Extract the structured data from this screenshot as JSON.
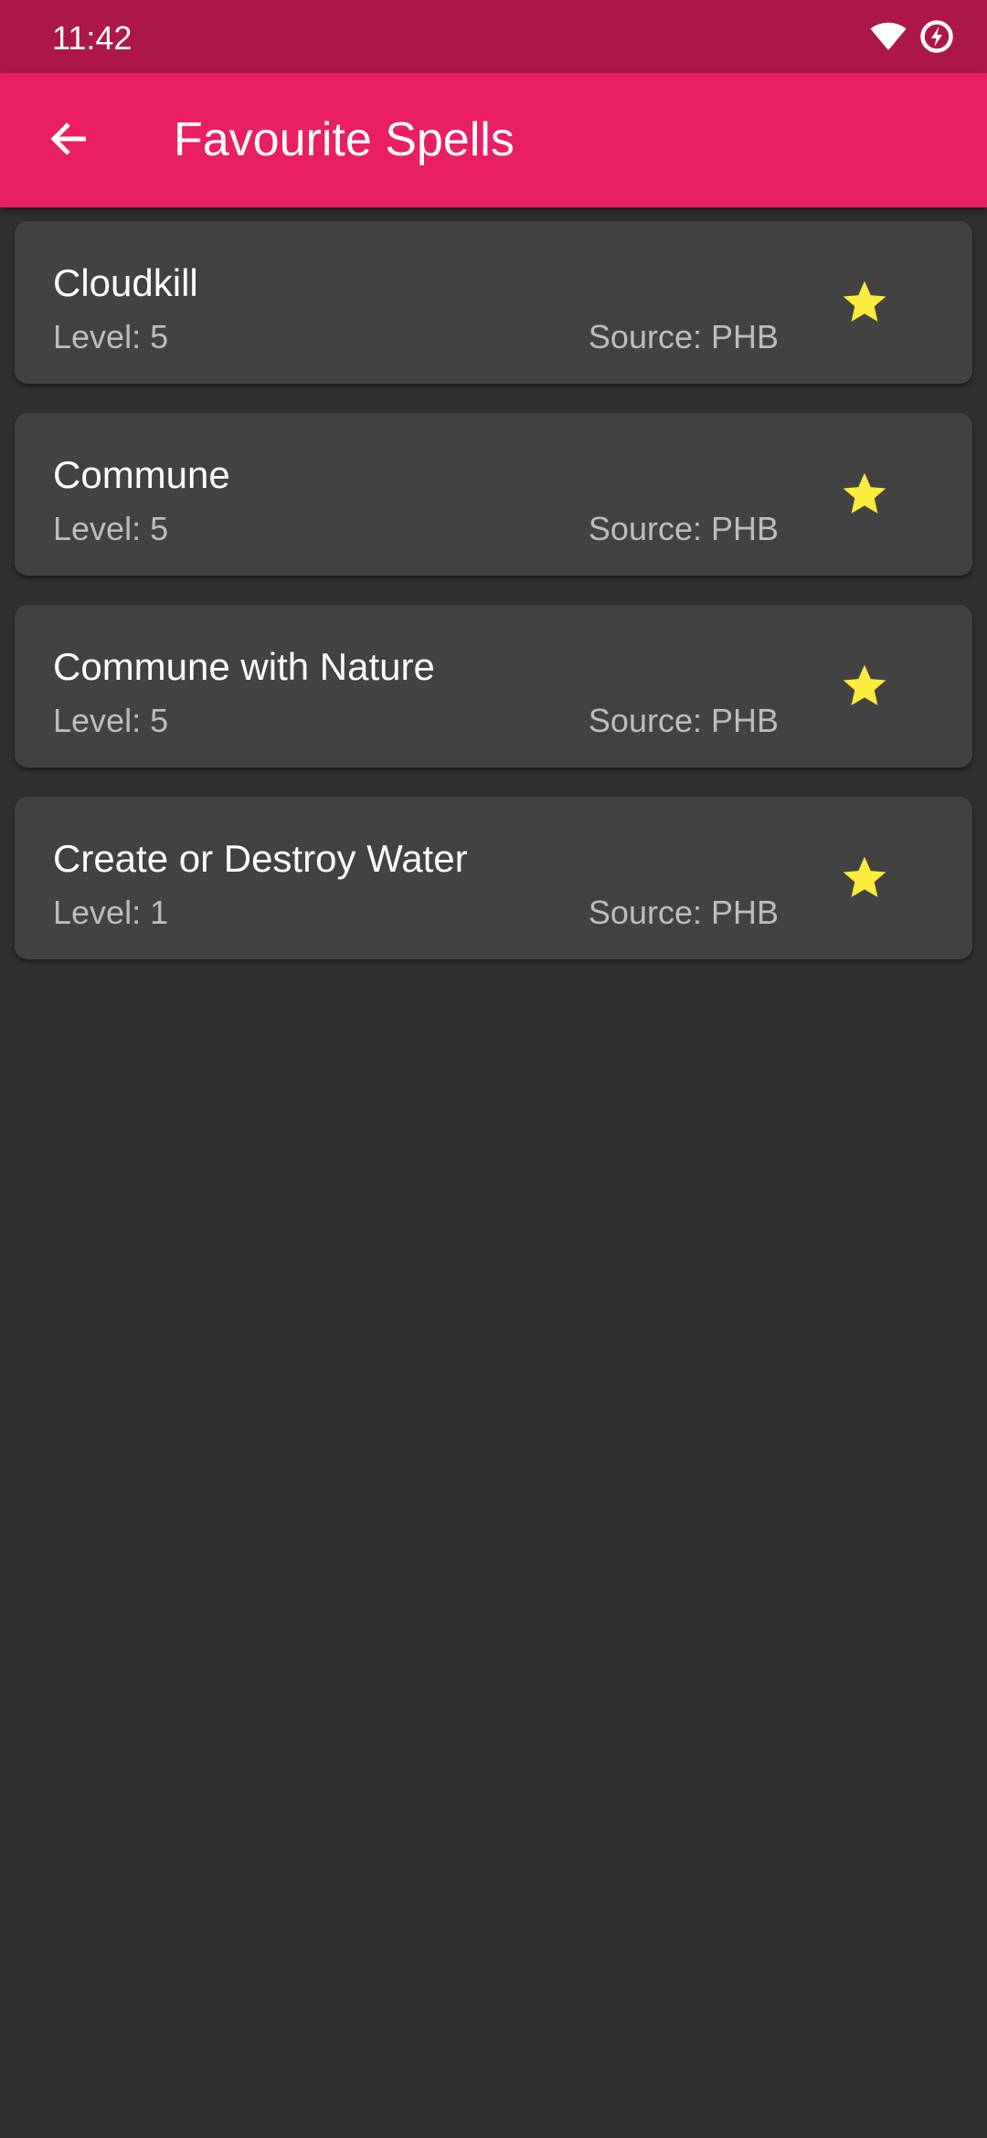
{
  "status_bar": {
    "time": "11:42",
    "icons": [
      "wifi-icon",
      "battery-charging-icon"
    ]
  },
  "app_bar": {
    "title": "Favourite Spells",
    "back_icon": "arrow-back-icon",
    "color": "#e91e63"
  },
  "colors": {
    "status_bar": "#ad1748",
    "background": "#303030",
    "card": "#424242",
    "star": "#ffeb3b"
  },
  "spells": [
    {
      "name": "Cloudkill",
      "level": "Level: 5",
      "source": "Source: PHB",
      "favourite": true
    },
    {
      "name": "Commune",
      "level": "Level: 5",
      "source": "Source: PHB",
      "favourite": true
    },
    {
      "name": "Commune with Nature",
      "level": "Level: 5",
      "source": "Source: PHB",
      "favourite": true
    },
    {
      "name": "Create or Destroy Water",
      "level": "Level: 1",
      "source": "Source: PHB",
      "favourite": true
    }
  ]
}
